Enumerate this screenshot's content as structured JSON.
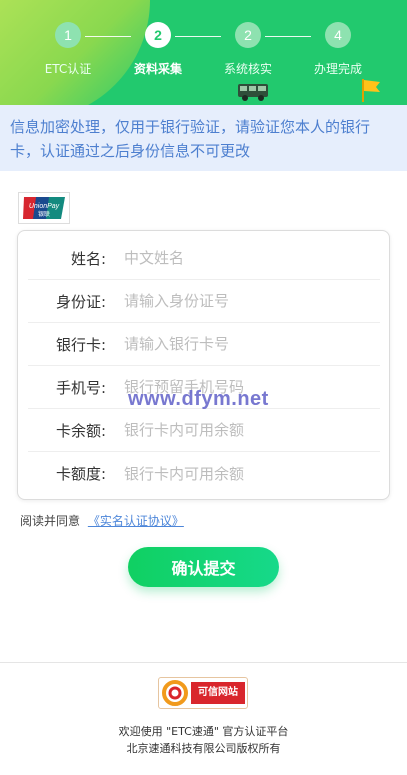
{
  "steps": [
    {
      "number": "1",
      "label": "ETC认证",
      "active": false
    },
    {
      "number": "2",
      "label": "资料采集",
      "active": true
    },
    {
      "number": "2",
      "label": "系统核实",
      "active": false
    },
    {
      "number": "4",
      "label": "办理完成",
      "active": false
    }
  ],
  "notice": "信息加密处理，仅用于银行验证，请验证您本人的银行卡，认证通过之后身份信息不可更改",
  "unionpay": {
    "line1": "UnionPay",
    "line2": "银联"
  },
  "form": {
    "fields": [
      {
        "label": "姓名:",
        "placeholder": "中文姓名"
      },
      {
        "label": "身份证:",
        "placeholder": "请输入身份证号"
      },
      {
        "label": "银行卡:",
        "placeholder": "请输入银行卡号"
      },
      {
        "label": "手机号:",
        "placeholder": "银行预留手机号码"
      },
      {
        "label": "卡余额:",
        "placeholder": "银行卡内可用余额"
      },
      {
        "label": "卡额度:",
        "placeholder": "银行卡内可用余额"
      }
    ]
  },
  "agreement": {
    "prefix": "阅读并同意",
    "link": "《实名认证协议》"
  },
  "submit_label": "确认提交",
  "watermark": "www.dfym.net",
  "footer": {
    "badge": "可信网站",
    "line1": "欢迎使用 \"ETC速通\" 官方认证平台",
    "line2": "北京速通科技有限公司版权所有"
  },
  "colors": {
    "header": "#22c96e",
    "notice_bg": "#e6eefc",
    "notice_text": "#4d7fcf",
    "button": "#10d062"
  }
}
